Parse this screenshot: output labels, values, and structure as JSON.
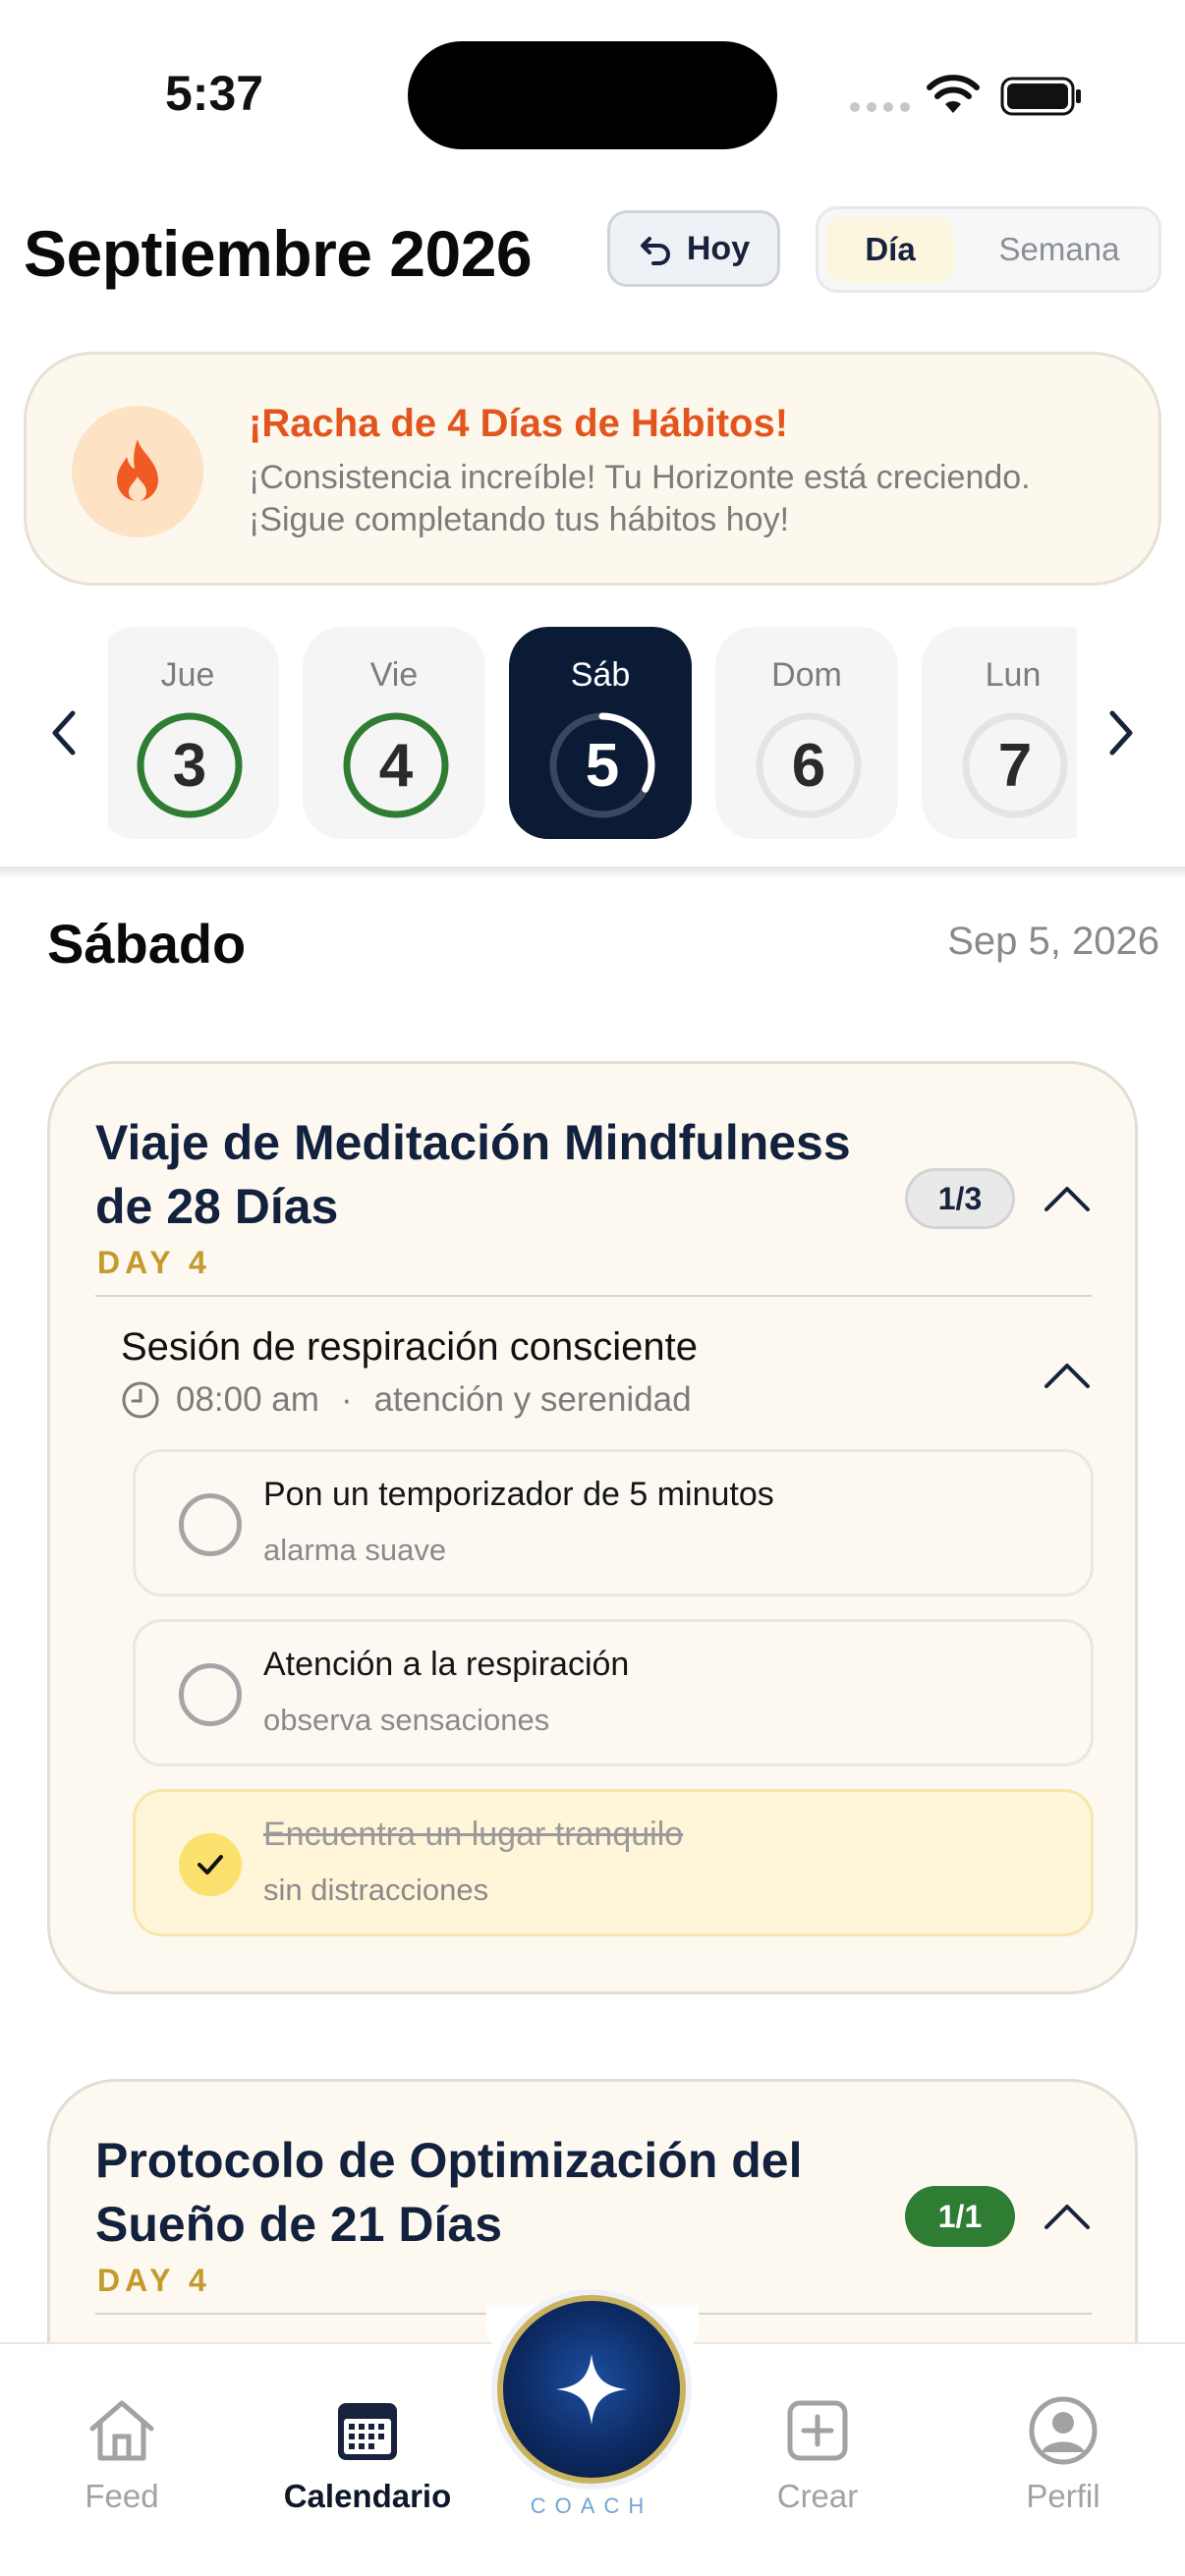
{
  "status_bar": {
    "time": "5:37"
  },
  "header": {
    "month_title": "Septiembre 2026",
    "today_label": "Hoy",
    "view_day": "Día",
    "view_week": "Semana"
  },
  "streak": {
    "title": "¡Racha de 4 Días de Hábitos!",
    "message": "¡Consistencia increíble! Tu Horizonte está creciendo. ¡Sigue completando tus hábitos hoy!"
  },
  "days": [
    {
      "name": "Jue",
      "number": "3",
      "progress": 1.0,
      "state": "complete"
    },
    {
      "name": "Vie",
      "number": "4",
      "progress": 1.0,
      "state": "complete"
    },
    {
      "name": "Sáb",
      "number": "5",
      "progress": 0.33,
      "state": "selected"
    },
    {
      "name": "Dom",
      "number": "6",
      "progress": 0,
      "state": "empty"
    },
    {
      "name": "Lun",
      "number": "7",
      "progress": 0,
      "state": "empty"
    }
  ],
  "selected_day": {
    "heading": "Sábado",
    "date": "Sep 5, 2026"
  },
  "programs": [
    {
      "title": "Viaje de Meditación Mindfulness de 28 Días",
      "day_label": "DAY 4",
      "badge": "1/3",
      "session": {
        "title": "Sesión de respiración consciente",
        "time": "08:00 am",
        "separator": "·",
        "tag": "atención y serenidad"
      },
      "tasks": [
        {
          "title": "Pon un temporizador de 5 minutos",
          "subtitle": "alarma suave",
          "done": false
        },
        {
          "title": "Atención a la respiración",
          "subtitle": "observa sensaciones",
          "done": false
        },
        {
          "title": "Encuentra un lugar tranquilo",
          "subtitle": "sin distracciones",
          "done": true
        }
      ]
    },
    {
      "title": "Protocolo de Optimización del Sueño de 21 Días",
      "day_label": "DAY 4",
      "badge": "1/1"
    }
  ],
  "tabbar": {
    "feed": "Feed",
    "calendar": "Calendario",
    "coach": "COACH",
    "create": "Crear",
    "profile": "Perfil"
  },
  "colors": {
    "accent_navy": "#0b1a35",
    "streak_orange": "#e2551c",
    "complete_green": "#2f7d33",
    "gold": "#c49a2c"
  }
}
